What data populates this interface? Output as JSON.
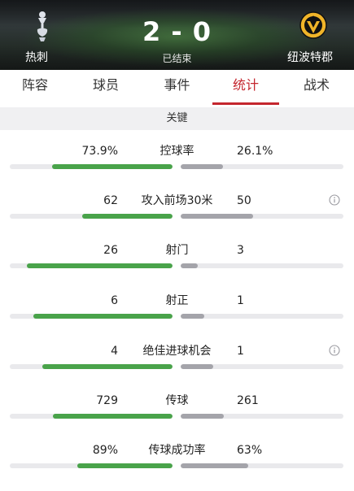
{
  "header": {
    "home_team": "热刺",
    "away_team": "纽波特郡",
    "score": "2 - 0",
    "status": "已结束",
    "background_pitch_color": "#3f6b3c"
  },
  "tabs": [
    {
      "label": "阵容",
      "active": false
    },
    {
      "label": "球员",
      "active": false
    },
    {
      "label": "事件",
      "active": false
    },
    {
      "label": "统计",
      "active": true
    },
    {
      "label": "战术",
      "active": false
    }
  ],
  "section": {
    "title": "关键"
  },
  "colors": {
    "home_bar": "#49a34a",
    "away_bar": "#a4a4aa",
    "accent": "#c4262e"
  },
  "stats": [
    {
      "label": "控球率",
      "home": "73.9%",
      "away": "26.1%",
      "home_share": 0.739,
      "away_share": 0.261,
      "info_icon": false
    },
    {
      "label": "攻入前场30米",
      "home": "62",
      "away": "50",
      "home_share": 0.554,
      "away_share": 0.446,
      "info_icon": true
    },
    {
      "label": "射门",
      "home": "26",
      "away": "3",
      "home_share": 0.897,
      "away_share": 0.103,
      "info_icon": false
    },
    {
      "label": "射正",
      "home": "6",
      "away": "1",
      "home_share": 0.857,
      "away_share": 0.143,
      "info_icon": false
    },
    {
      "label": "绝佳进球机会",
      "home": "4",
      "away": "1",
      "home_share": 0.8,
      "away_share": 0.2,
      "info_icon": true
    },
    {
      "label": "传球",
      "home": "729",
      "away": "261",
      "home_share": 0.736,
      "away_share": 0.264,
      "info_icon": false
    },
    {
      "label": "传球成功率",
      "home": "89%",
      "away": "63%",
      "home_share": 0.585,
      "away_share": 0.415,
      "info_icon": false
    }
  ]
}
